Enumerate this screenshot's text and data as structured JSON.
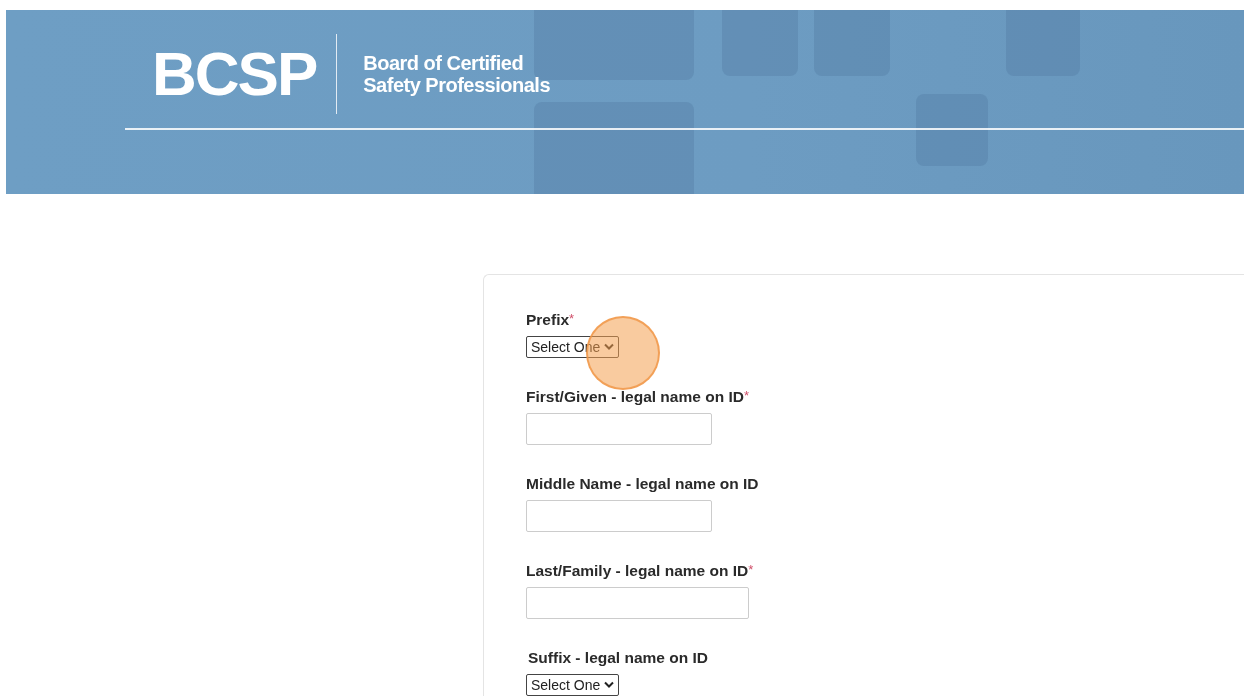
{
  "header": {
    "logo": "BCSP",
    "organization": [
      "Board of Certified",
      "Safety Professionals"
    ]
  },
  "form": {
    "fields": [
      {
        "kind": "select",
        "label": "Prefix",
        "required_mark": "*",
        "value": "Select One",
        "clicked": true
      },
      {
        "kind": "text",
        "label": "First/Given - legal name on ID",
        "required_mark": "*"
      },
      {
        "kind": "text",
        "label": "Middle Name - legal name on ID"
      },
      {
        "kind": "text",
        "label": "Last/Family - legal name on ID",
        "required_mark": "*"
      },
      {
        "kind": "select",
        "label": "Suffix - legal name on ID",
        "value": "Select One",
        "clicked": false
      }
    ]
  }
}
